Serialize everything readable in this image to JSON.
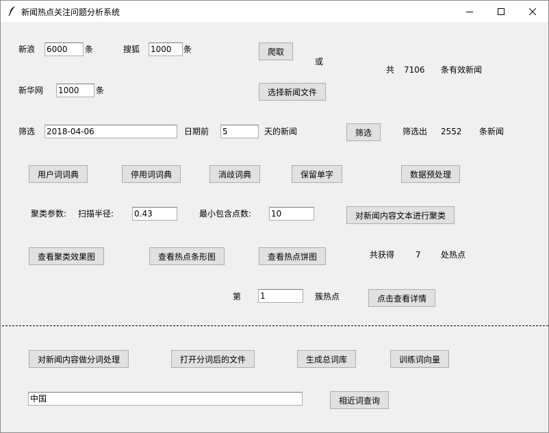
{
  "window": {
    "title": "新闻热点关注问题分析系统",
    "icon": "feather-icon"
  },
  "crawl": {
    "sina_label": "新浪",
    "sina_value": "6000",
    "sina_unit": "条",
    "sohu_label": "搜狐",
    "sohu_value": "1000",
    "sohu_unit": "条",
    "xinhua_label": "新华网",
    "xinhua_value": "1000",
    "xinhua_unit": "条",
    "crawl_button": "爬取",
    "or_label": "或",
    "choose_file_button": "选择新闻文件",
    "total_prefix": "共",
    "total_count": "7106",
    "total_suffix": "条有效新闻"
  },
  "filter": {
    "label": "筛选",
    "date_value": "2018-04-06",
    "before_label": "日期前",
    "days_value": "5",
    "days_suffix": "天的新闻",
    "filter_button": "筛选",
    "result_prefix": "筛选出",
    "result_count": "2552",
    "result_suffix": "条新闻"
  },
  "dicts": {
    "user_dict_button": "用户词词典",
    "stop_dict_button": "停用词词典",
    "disambig_dict_button": "消歧词典",
    "keep_single_button": "保留单字",
    "preprocess_button": "数据预处理"
  },
  "cluster": {
    "params_label": "聚类参数:",
    "radius_label": "扫描半径:",
    "radius_value": "0.43",
    "min_points_label": "最小包含点数:",
    "min_points_value": "10",
    "cluster_button": "对新闻内容文本进行聚类"
  },
  "results": {
    "cluster_plot_button": "查看聚类效果图",
    "bar_chart_button": "查看热点条形图",
    "pie_chart_button": "查看热点饼图",
    "got_prefix": "共获得",
    "hotspot_count": "7",
    "got_suffix": "处热点",
    "nth_label": "第",
    "cluster_index": "1",
    "cluster_suffix": "簇热点",
    "details_button": "点击查看详情"
  },
  "words": {
    "segment_button": "对新闻内容做分词处理",
    "open_segmented_button": "打开分词后的文件",
    "build_corpus_button": "生成总词库",
    "train_vectors_button": "训练词向量",
    "query_value": "中国",
    "similar_button": "相近词查询"
  }
}
